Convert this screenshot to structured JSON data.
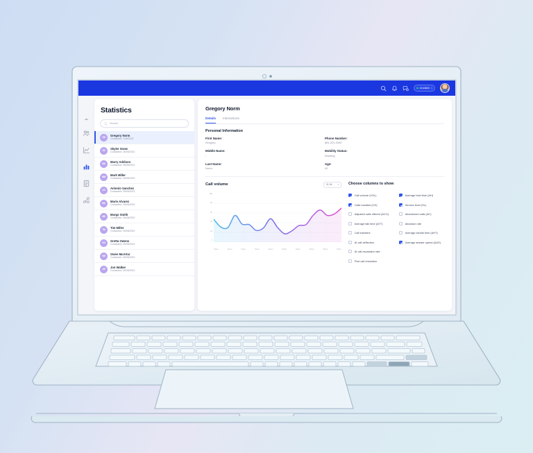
{
  "topbar": {
    "icons": [
      "search-icon",
      "bell-icon",
      "chat-icon"
    ],
    "status_label": "Available",
    "status_color": "#21d07a",
    "caret": "▾"
  },
  "rail": {
    "items": [
      {
        "name": "dashboard-icon",
        "active": false
      },
      {
        "name": "users-icon",
        "active": false
      },
      {
        "name": "line-chart-icon",
        "active": false
      },
      {
        "name": "bar-chart-icon",
        "active": true
      },
      {
        "name": "document-icon",
        "active": false
      },
      {
        "name": "network-icon",
        "active": false
      }
    ]
  },
  "sidebar": {
    "title": "Statistics",
    "search_placeholder": "Search",
    "contacts": [
      {
        "initials": "GN",
        "name": "Gregory Norm",
        "sub": "Contacted: 1/06/2022",
        "selected": true
      },
      {
        "initials": "SS",
        "name": "Skyler Snow",
        "sub": "Contacted: 26/05/2022",
        "selected": false
      },
      {
        "initials": "MA",
        "name": "Marry Addison",
        "sub": "Contacted: 26/05/2022",
        "selected": false
      },
      {
        "initials": "MM",
        "name": "Mark Miller",
        "sub": "Contacted: 26/05/2022",
        "selected": false
      },
      {
        "initials": "AS",
        "name": "Antonio Sanchez",
        "sub": "Contacted: 25/05/2022",
        "selected": false
      },
      {
        "initials": "MA",
        "name": "Mario Alvarez",
        "sub": "Contacted: 25/05/2022",
        "selected": false
      },
      {
        "initials": "MS",
        "name": "Margo Smith",
        "sub": "Contacted: 25/05/2022",
        "selected": false
      },
      {
        "initials": "TM",
        "name": "Tim Miller",
        "sub": "Contacted: 25/05/2022",
        "selected": false
      },
      {
        "initials": "GO",
        "name": "Gretta Owens",
        "sub": "Contacted: 25/05/2022",
        "selected": false
      },
      {
        "initials": "OM",
        "name": "Owen McArtur",
        "sub": "Contacted: 25/05/2022",
        "selected": false
      },
      {
        "initials": "JW",
        "name": "Jon Walker",
        "sub": "Contacted: 25/05/2022",
        "selected": false
      }
    ]
  },
  "main": {
    "person_name": "Gregory Norm",
    "tabs": [
      {
        "label": "Details",
        "active": true
      },
      {
        "label": "Interactions",
        "active": false
      }
    ],
    "section_title": "Personal Information",
    "fields": [
      {
        "label": "First Name:",
        "value": "Gregory"
      },
      {
        "label": "Phone Number:",
        "value": "881-321-0987"
      },
      {
        "label": "Middle Name:",
        "value": "-"
      },
      {
        "label": "Mobility Status:",
        "value": "Working"
      },
      {
        "label": "Last Name:",
        "value": "Norm"
      },
      {
        "label": "Age:",
        "value": "42"
      }
    ]
  },
  "chart_panel": {
    "date_value": "01.06",
    "caret": "▾"
  },
  "columns": {
    "title": "Choose columns to show",
    "left": [
      {
        "label": "Call volume (VOL)",
        "checked": true
      },
      {
        "label": "Calls handled (CH)",
        "checked": true
      },
      {
        "label": "Adjusted calls offered (ACO)",
        "checked": false
      },
      {
        "label": "Average talk time (ATT)",
        "checked": false
      },
      {
        "label": "Call transfers",
        "checked": false
      },
      {
        "label": "AI call deflection",
        "checked": false
      },
      {
        "label": "AI call escalation rate",
        "checked": false
      },
      {
        "label": "First call resolution",
        "checked": false
      }
    ],
    "right": [
      {
        "label": "Average hold time (AH)",
        "checked": true
      },
      {
        "label": "Service level (SL)",
        "checked": true
      },
      {
        "label": "Abandoned calls (AC)",
        "checked": false
      },
      {
        "label": "Abandon rate",
        "checked": false
      },
      {
        "label": "Average handle time (AHT)",
        "checked": false
      },
      {
        "label": "Average answer speed (AAS)",
        "checked": true
      }
    ]
  },
  "chart_data": {
    "type": "line",
    "title": "Call volume",
    "xlabel": "",
    "ylabel": "",
    "ylim": [
      0,
      100
    ],
    "yticks": [
      0,
      20,
      40,
      60,
      80,
      100
    ],
    "ytick_labels": [
      "0",
      "20",
      "40",
      "60",
      "80",
      "100"
    ],
    "grid": true,
    "legend": "none",
    "x": [
      "10am",
      "11am",
      "12am",
      "01am",
      "02am",
      "03am",
      "04am",
      "05am",
      "06am",
      "07am"
    ],
    "series": [
      {
        "name": "Call volume",
        "gradient": [
          "#4DBBEF",
          "#7B6FE8",
          "#E04FD0"
        ],
        "area_fill": true,
        "values": [
          47,
          31,
          30,
          55,
          37,
          36,
          24,
          29,
          48,
          30,
          17,
          23,
          34,
          36,
          55,
          66,
          55,
          58,
          70
        ]
      }
    ]
  }
}
